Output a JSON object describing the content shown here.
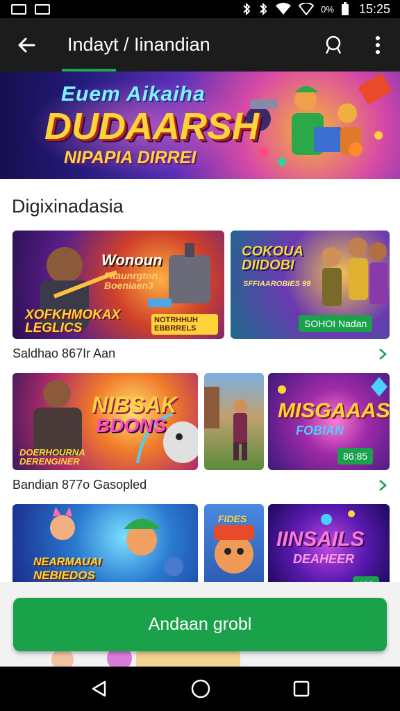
{
  "status_bar": {
    "battery_percent": "0%",
    "time": "15:25"
  },
  "app_bar": {
    "title": "Indayt / Iinandian"
  },
  "hero": {
    "line1": "Euem Aikaiha",
    "line2": "DUDAARSH",
    "line3": "NIPAPIA DIRREI"
  },
  "section": {
    "title": "Digixinadasia"
  },
  "rows": [
    {
      "label": "Saldhao 867Ir Aan",
      "tiles": [
        {
          "caption_top": "Wonoun",
          "caption_mid": "Faaunrgton Boeniaen3",
          "caption_bottom": "XOFKHMOKAX LEGLICS",
          "badge": "NOTRHHUH EBBRRELS"
        },
        {
          "caption_top": "COKOUA DIIDOBI",
          "caption_mid": "SFFIAAROBIES 99",
          "tag": "SOHOI Nadan"
        }
      ]
    },
    {
      "label": "Bandian 877o Gasopled",
      "tiles": [
        {
          "caption_top": "NIBSAK",
          "caption_mid": "BDONS",
          "caption_bottom": "DOERHOURNA DERENGINER"
        },
        {
          "caption_top": ""
        },
        {
          "caption_top": "MISGAAAS",
          "caption_mid": "FOBIAN",
          "tag": "86:85"
        }
      ]
    },
    {
      "tiles": [
        {
          "caption_top": "NEARMAUAI",
          "caption_mid": "NEBIEDOS"
        },
        {
          "caption_top": "FIDES"
        },
        {
          "caption_top": "IINSAILS",
          "caption_mid": "DEAHEER",
          "tag": "112"
        }
      ]
    }
  ],
  "cta": {
    "label": "Andaan grobl"
  },
  "colors": {
    "accent": "#19a24a",
    "appbar": "#1c1c1c"
  },
  "icons": [
    "back-arrow-icon",
    "search-icon",
    "more-vert-icon",
    "chevron-right-icon",
    "nav-back-icon",
    "nav-home-icon",
    "nav-recents-icon"
  ]
}
